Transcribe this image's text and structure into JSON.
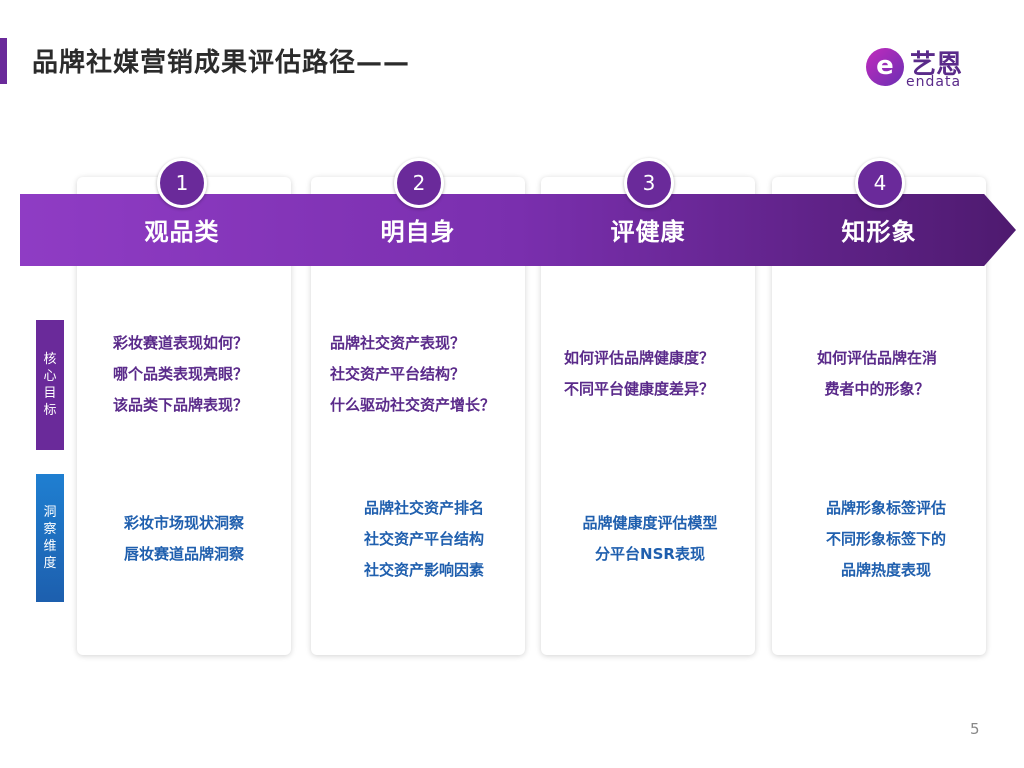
{
  "header": {
    "title": "品牌社媒营销成果评估路径——"
  },
  "logo": {
    "mark": "e",
    "cn": "艺恩",
    "en": "endata"
  },
  "steps": [
    {
      "num": "1",
      "title": "观品类",
      "goals": [
        "彩妆赛道表现如何？",
        "哪个品类表现亮眼？",
        "该品类下品牌表现？"
      ],
      "insights": [
        "彩妆市场现状洞察",
        "唇妆赛道品牌洞察"
      ]
    },
    {
      "num": "2",
      "title": "明自身",
      "goals": [
        "品牌社交资产表现？",
        "社交资产平台结构？",
        "什么驱动社交资产增长？"
      ],
      "insights": [
        "品牌社交资产排名",
        "社交资产平台结构",
        "社交资产影响因素"
      ]
    },
    {
      "num": "3",
      "title": "评健康",
      "goals": [
        "如何评估品牌健康度？",
        "不同平台健康度差异？"
      ],
      "insights": [
        "品牌健康度评估模型",
        "分平台NSR表现"
      ]
    },
    {
      "num": "4",
      "title": "知形象",
      "goals": [
        "如何评估品牌在消",
        "费者中的形象？"
      ],
      "insights": [
        "品牌形象标签评估",
        "不同形象标签下的",
        "品牌热度表现"
      ]
    }
  ],
  "side_labels": {
    "goal": [
      "核",
      "心",
      "目",
      "标"
    ],
    "insight": [
      "洞",
      "察",
      "维",
      "度"
    ]
  },
  "page_number": "5",
  "colors": {
    "purple": "#6a2a9a",
    "blue": "#1f5fae"
  }
}
